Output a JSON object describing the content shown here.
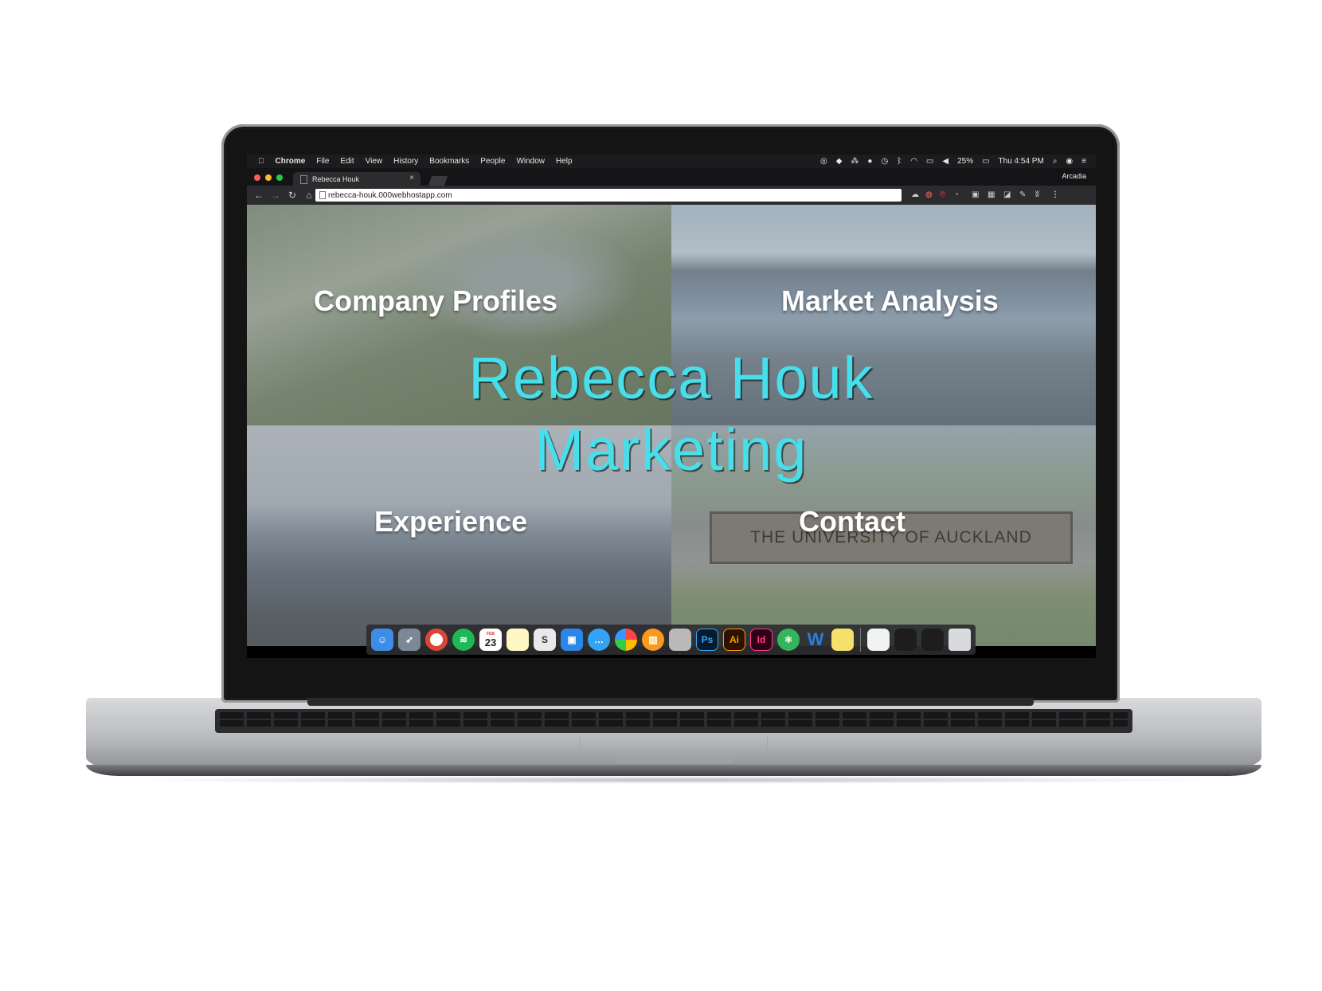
{
  "menubar": {
    "apple": "",
    "app": "Chrome",
    "menus": [
      "File",
      "Edit",
      "View",
      "History",
      "Bookmarks",
      "People",
      "Window",
      "Help"
    ],
    "battery": "25%",
    "clock": "Thu 4:54 PM"
  },
  "tabstrip": {
    "tab_title": "Rebecca Houk",
    "close": "×",
    "profile": "Arcadia"
  },
  "toolbar": {
    "url": "rebecca-houk.000webhostapp.com",
    "back": "←",
    "forward": "→",
    "reload": "↻",
    "home": "⌂",
    "menu": "⋮"
  },
  "site": {
    "tiles": [
      "Company Profiles",
      "Market Analysis",
      "Experience",
      "Contact"
    ],
    "title_line1": "Rebecca Houk",
    "title_line2": "Marketing",
    "sign_text": "THE UNIVERSITY OF AUCKLAND"
  },
  "dock": {
    "calendar_day": "23",
    "calendar_month": "FEB",
    "ps": "Ps",
    "ai": "Ai",
    "id": "Id",
    "w": "W"
  },
  "colors": {
    "title": "#45e0ec",
    "tile_text": "#ffffff"
  }
}
